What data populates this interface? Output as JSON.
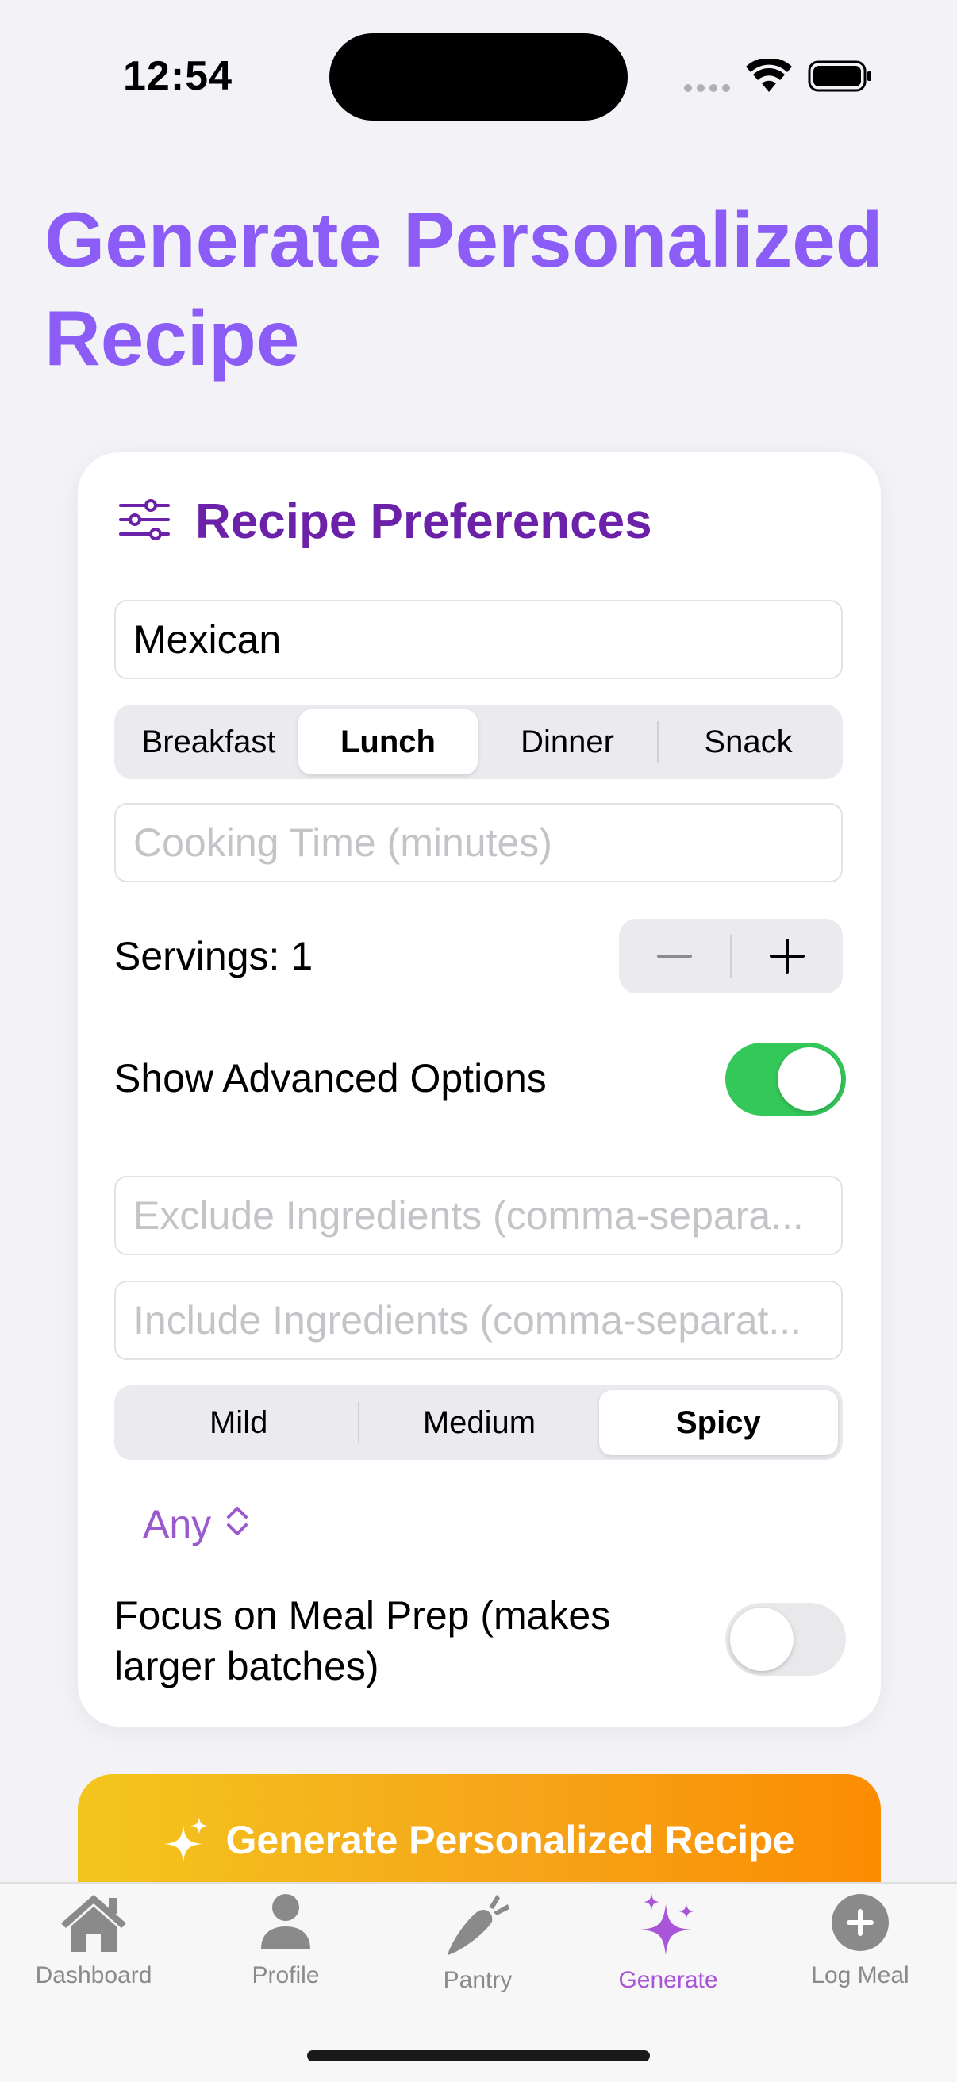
{
  "status_bar": {
    "time": "12:54"
  },
  "page": {
    "title": "Generate Personalized Recipe"
  },
  "card": {
    "title": "Recipe Preferences",
    "cuisine_value": "Mexican",
    "meal_types": [
      "Breakfast",
      "Lunch",
      "Dinner",
      "Snack"
    ],
    "meal_type_selected": "Lunch",
    "cooking_time_placeholder": "Cooking Time (minutes)",
    "servings_label": "Servings: 1",
    "advanced_label": "Show Advanced Options",
    "advanced_on": true,
    "exclude_placeholder": "Exclude Ingredients (comma-separa...",
    "include_placeholder": "Include Ingredients (comma-separat...",
    "spice_levels": [
      "Mild",
      "Medium",
      "Spicy"
    ],
    "spice_selected": "Spicy",
    "picker_value": "Any",
    "meal_prep_label_1": "Focus on Meal Prep (makes",
    "meal_prep_label_2": "larger batches)",
    "meal_prep_on": false
  },
  "generate_button": {
    "label": "Generate Personalized Recipe",
    "icon": "sparkles-icon"
  },
  "tabbar": {
    "tabs": [
      {
        "label": "Dashboard",
        "icon": "house-icon"
      },
      {
        "label": "Profile",
        "icon": "person-icon"
      },
      {
        "label": "Pantry",
        "icon": "carrot-icon"
      },
      {
        "label": "Generate",
        "icon": "sparkles-icon"
      },
      {
        "label": "Log Meal",
        "icon": "plus-circle-icon"
      }
    ],
    "active": "Generate"
  },
  "colors": {
    "title": "#8b5cf6",
    "card_title": "#6b21a8",
    "toggle_on": "#34c759",
    "accent": "#a855d8",
    "button_start": "#f3c61e",
    "button_end": "#fb8c00"
  }
}
